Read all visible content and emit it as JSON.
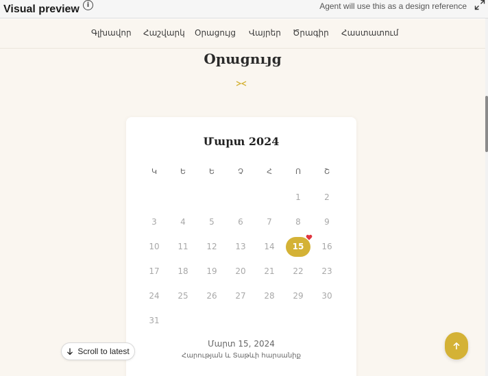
{
  "preview": {
    "title": "Visual preview",
    "info_icon": "info-icon",
    "note": "Agent will use this as a design reference",
    "expand_icon": "expand-icon"
  },
  "nav": {
    "items": [
      {
        "label": "Գլխավոր"
      },
      {
        "label": "Հաշվարկ"
      },
      {
        "label": "Օրացույց"
      },
      {
        "label": "Վայրեր"
      },
      {
        "label": "Ծրագիր"
      },
      {
        "label": "Հաստատում"
      }
    ]
  },
  "section": {
    "title": "Օրացույց",
    "ornament_icon": "ornament-icon"
  },
  "calendar": {
    "month_title": "Մարտ 2024",
    "weekdays": [
      "Կ",
      "Ե",
      "Ե",
      "Չ",
      "Հ",
      "Ո",
      "Շ"
    ],
    "days": [
      {
        "label": "1"
      },
      {
        "label": "2"
      },
      {
        "label": "3"
      },
      {
        "label": "4"
      },
      {
        "label": "5"
      },
      {
        "label": "6"
      },
      {
        "label": "7"
      },
      {
        "label": "8"
      },
      {
        "label": "9"
      },
      {
        "label": "10"
      },
      {
        "label": "11"
      },
      {
        "label": "12"
      },
      {
        "label": "13"
      },
      {
        "label": "14"
      },
      {
        "label": "15"
      },
      {
        "label": "16"
      },
      {
        "label": "17"
      },
      {
        "label": "18"
      },
      {
        "label": "19"
      },
      {
        "label": "20"
      },
      {
        "label": "21"
      },
      {
        "label": "22"
      },
      {
        "label": "23"
      },
      {
        "label": "24"
      },
      {
        "label": "25"
      },
      {
        "label": "26"
      },
      {
        "label": "27"
      },
      {
        "label": "28"
      },
      {
        "label": "29"
      },
      {
        "label": "30"
      },
      {
        "label": "31"
      }
    ],
    "selected_day": "15",
    "selected_date": "Մարտ 15, 2024",
    "selected_event": "Հարության և Տաթևի հարսանիք",
    "heart_icon": "heart-icon"
  },
  "actions": {
    "scroll_top_icon": "arrow-up-icon",
    "scroll_latest_label": "Scroll to latest",
    "scroll_latest_icon": "arrow-down-icon"
  },
  "colors": {
    "accent": "#d4b236",
    "page_background": "#faf6f0",
    "heart": "#e0353f"
  }
}
